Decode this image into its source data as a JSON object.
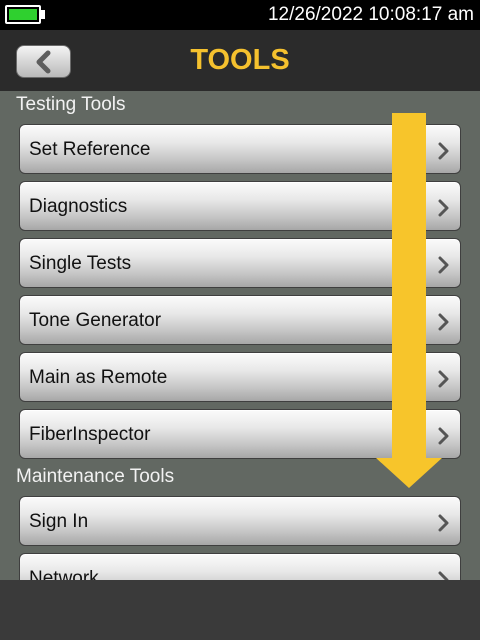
{
  "status_bar": {
    "datetime": "12/26/2022  10:08:17 am",
    "battery_level": 1.0,
    "battery_color": "#2fd02f"
  },
  "header": {
    "title": "TOOLS",
    "title_color": "#f5c12e",
    "back_icon": "chevron-left-icon"
  },
  "sections": {
    "testing": {
      "label": "Testing Tools",
      "items": [
        {
          "label": "Set Reference"
        },
        {
          "label": "Diagnostics"
        },
        {
          "label": "Single Tests"
        },
        {
          "label": "Tone Generator"
        },
        {
          "label": "Main as Remote"
        },
        {
          "label": "FiberInspector"
        }
      ]
    },
    "maintenance": {
      "label": "Maintenance Tools",
      "items": [
        {
          "label": "Sign In"
        },
        {
          "label": "Network"
        }
      ]
    }
  },
  "overlay": {
    "scroll_arrow_icon": "down-arrow-icon",
    "scroll_arrow_color": "#f7c52b"
  },
  "item_icon": "chevron-right-icon"
}
